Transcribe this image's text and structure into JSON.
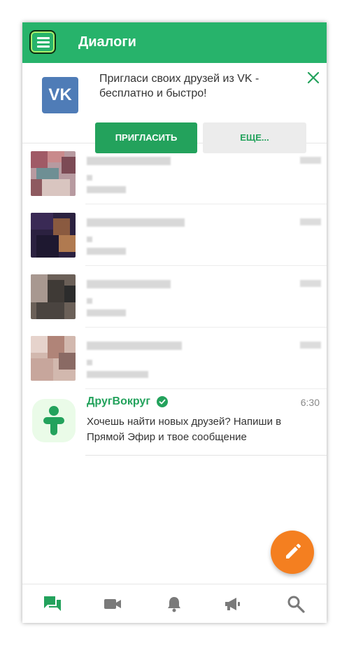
{
  "header": {
    "title": "Диалоги"
  },
  "invite": {
    "logo_text": "VK",
    "text_line1": "Пригласи своих друзей из VK -",
    "text_line2": "бесплатно и быстро!",
    "invite_button": "ПРИГЛАСИТЬ",
    "more_button": "ЕЩЕ..."
  },
  "conversations": [
    {
      "name": "",
      "preview": "",
      "time": "",
      "blurred": true
    },
    {
      "name": "",
      "preview": "",
      "time": "",
      "blurred": true
    },
    {
      "name": "",
      "preview": "",
      "time": "",
      "blurred": true
    },
    {
      "name": "",
      "preview": "",
      "time": "",
      "blurred": true
    }
  ],
  "featured": {
    "name": "ДругВокруг",
    "time": "6:30",
    "message": "Хочешь найти новых друзей? Напиши в Прямой Эфир и твое сообщение"
  },
  "colors": {
    "brand_green": "#27b36b",
    "button_green": "#23a25c",
    "fab_orange": "#f47f20",
    "vk_blue": "#4f7cb7"
  },
  "icons": {
    "menu": "hamburger-menu-icon",
    "close": "close-icon",
    "verified": "verified-check-icon",
    "fab": "pencil-icon",
    "tabs": [
      "chat-icon",
      "video-camera-icon",
      "bell-icon",
      "megaphone-icon",
      "search-icon"
    ]
  }
}
